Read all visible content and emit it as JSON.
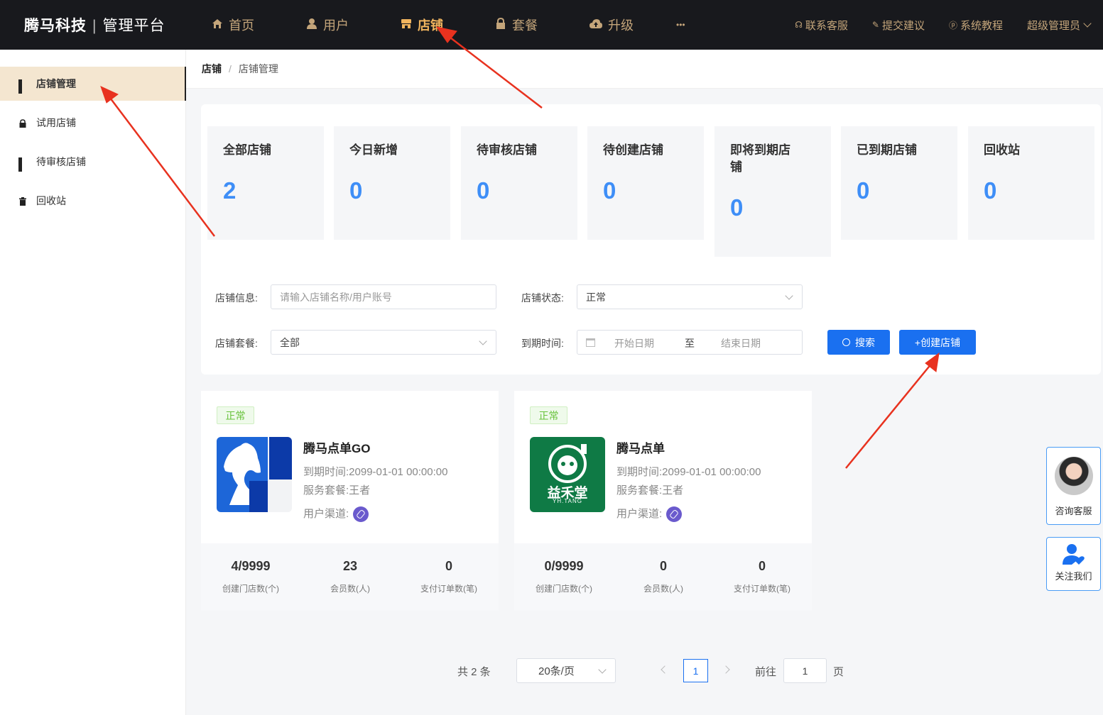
{
  "header": {
    "brand": "腾马科技",
    "brand_sep": "|",
    "brand_sub": "管理平台",
    "nav": [
      {
        "label": "首页",
        "icon": "home-icon"
      },
      {
        "label": "用户",
        "icon": "user-icon"
      },
      {
        "label": "店铺",
        "icon": "store-icon",
        "active": true
      },
      {
        "label": "套餐",
        "icon": "lock-icon"
      },
      {
        "label": "升级",
        "icon": "upgrade-icon"
      },
      {
        "label": "•••",
        "icon": "more-icon"
      }
    ],
    "right": [
      {
        "label": "联系客服",
        "icon": "headset-icon"
      },
      {
        "label": "提交建议",
        "icon": "edit-icon"
      },
      {
        "label": "系统教程",
        "icon": "help-icon"
      },
      {
        "label": "超级管理员",
        "icon": "chevron-down-icon"
      }
    ]
  },
  "sidebar": {
    "items": [
      {
        "label": "店铺管理",
        "icon": "grid-icon",
        "active": true
      },
      {
        "label": "试用店铺",
        "icon": "lock-icon"
      },
      {
        "label": "待审核店铺",
        "icon": "grid-icon"
      },
      {
        "label": "回收站",
        "icon": "trash-icon"
      }
    ]
  },
  "breadcrumb": {
    "first": "店铺",
    "sep": "/",
    "second": "店铺管理"
  },
  "stats": [
    {
      "title": "全部店铺",
      "value": "2"
    },
    {
      "title": "今日新增",
      "value": "0"
    },
    {
      "title": "待审核店铺",
      "value": "0"
    },
    {
      "title": "待创建店铺",
      "value": "0"
    },
    {
      "title": "即将到期店铺",
      "value": "0"
    },
    {
      "title": "已到期店铺",
      "value": "0"
    },
    {
      "title": "回收站",
      "value": "0"
    }
  ],
  "filters": {
    "info_label": "店铺信息:",
    "info_placeholder": "请输入店铺名称/用户账号",
    "status_label": "店铺状态:",
    "status_value": "正常",
    "package_label": "店铺套餐:",
    "package_value": "全部",
    "expire_label": "到期时间:",
    "start_placeholder": "开始日期",
    "range_sep": "至",
    "end_placeholder": "结束日期",
    "search_button": "搜索",
    "create_button": "+创建店铺"
  },
  "stores": [
    {
      "status": "正常",
      "name": "腾马点单GO",
      "expire_label": "到期时间:",
      "expire": "2099-01-01 00:00:00",
      "package_label": "服务套餐:",
      "package": "王者",
      "channel_label": "用户渠道:",
      "logo": "horse-logo",
      "stats": [
        {
          "value": "4/9999",
          "label": "创建门店数(个)"
        },
        {
          "value": "23",
          "label": "会员数(人)"
        },
        {
          "value": "0",
          "label": "支付订单数(笔)"
        }
      ]
    },
    {
      "status": "正常",
      "name": "腾马点单",
      "expire_label": "到期时间:",
      "expire": "2099-01-01 00:00:00",
      "package_label": "服务套餐:",
      "package": "王者",
      "channel_label": "用户渠道:",
      "logo": "yhtang-logo",
      "logo_text": "益禾堂",
      "logo_sub": "YH.TANG",
      "stats": [
        {
          "value": "0/9999",
          "label": "创建门店数(个)"
        },
        {
          "value": "0",
          "label": "会员数(人)"
        },
        {
          "value": "0",
          "label": "支付订单数(笔)"
        }
      ]
    }
  ],
  "pagination": {
    "total": "共 2 条",
    "page_size": "20条/页",
    "current": "1",
    "goto_label": "前往",
    "goto_value": "1",
    "page_suffix": "页"
  },
  "floating": {
    "consult": "咨询客服",
    "follow": "关注我们"
  },
  "colors": {
    "topbar": "#18191d",
    "nav_text": "#c4a57a",
    "nav_active": "#f0b45e",
    "accent_blue": "#1a70f0",
    "stat_blue": "#3e8ef7",
    "arrow_red": "#e8321f"
  }
}
